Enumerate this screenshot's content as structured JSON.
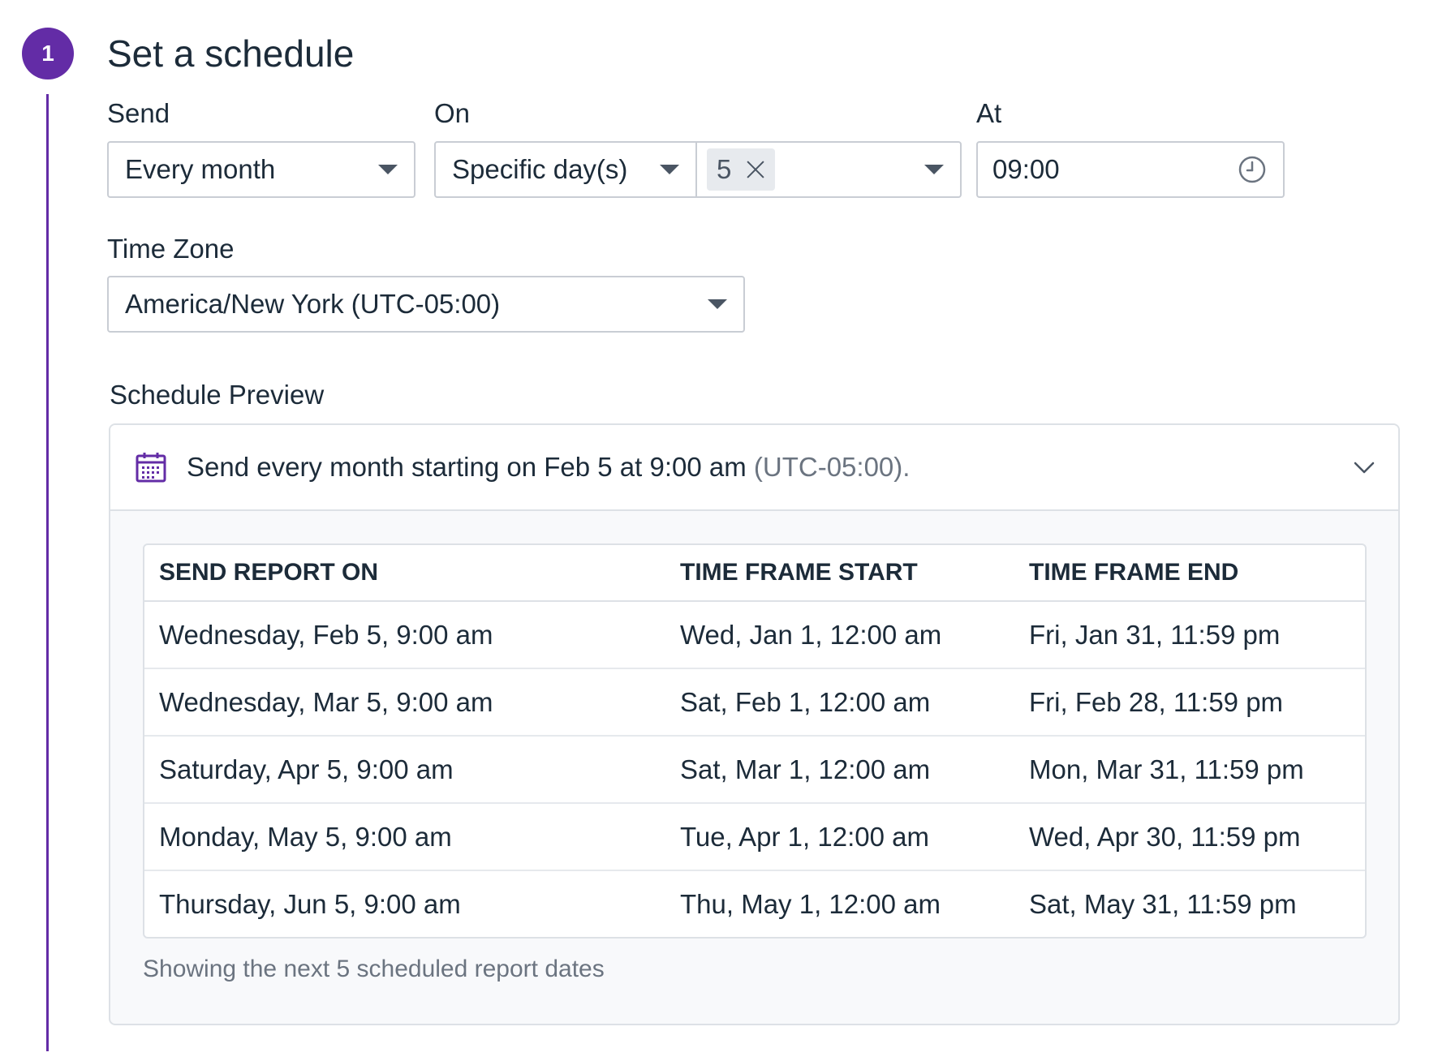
{
  "step": {
    "number": "1",
    "title": "Set a schedule"
  },
  "send": {
    "label": "Send",
    "value": "Every month"
  },
  "on": {
    "label": "On",
    "mode": "Specific day(s)",
    "selected_days": [
      "5"
    ]
  },
  "at": {
    "label": "At",
    "value": "09:00"
  },
  "timezone": {
    "label": "Time Zone",
    "value": "America/New York (UTC-05:00)"
  },
  "preview": {
    "label": "Schedule Preview",
    "summary": "Send every month starting on Feb 5 at 9:00 am",
    "summary_tz": "(UTC-05:00).",
    "columns": [
      "SEND REPORT ON",
      "TIME FRAME START",
      "TIME FRAME END"
    ],
    "rows": [
      [
        "Wednesday, Feb 5, 9:00 am",
        "Wed, Jan 1, 12:00 am",
        "Fri, Jan 31, 11:59 pm"
      ],
      [
        "Wednesday, Mar 5, 9:00 am",
        "Sat, Feb 1, 12:00 am",
        "Fri, Feb 28, 11:59 pm"
      ],
      [
        "Saturday, Apr 5, 9:00 am",
        "Sat, Mar 1, 12:00 am",
        "Mon, Mar 31, 11:59 pm"
      ],
      [
        "Monday, May 5, 9:00 am",
        "Tue, Apr 1, 12:00 am",
        "Wed, Apr 30, 11:59 pm"
      ],
      [
        "Thursday, Jun 5, 9:00 am",
        "Thu, May 1, 12:00 am",
        "Sat, May 31, 11:59 pm"
      ]
    ],
    "footnote": "Showing the next 5 scheduled report dates"
  },
  "colors": {
    "accent": "#632ca6",
    "border": "#c9cdd4",
    "text": "#1c2b39",
    "muted": "#6b7480"
  },
  "icons": {
    "time": "clock-icon",
    "preview": "calendar-icon",
    "expand": "chevron-down-icon",
    "dropdown": "caret-down-icon",
    "remove": "close-icon"
  }
}
